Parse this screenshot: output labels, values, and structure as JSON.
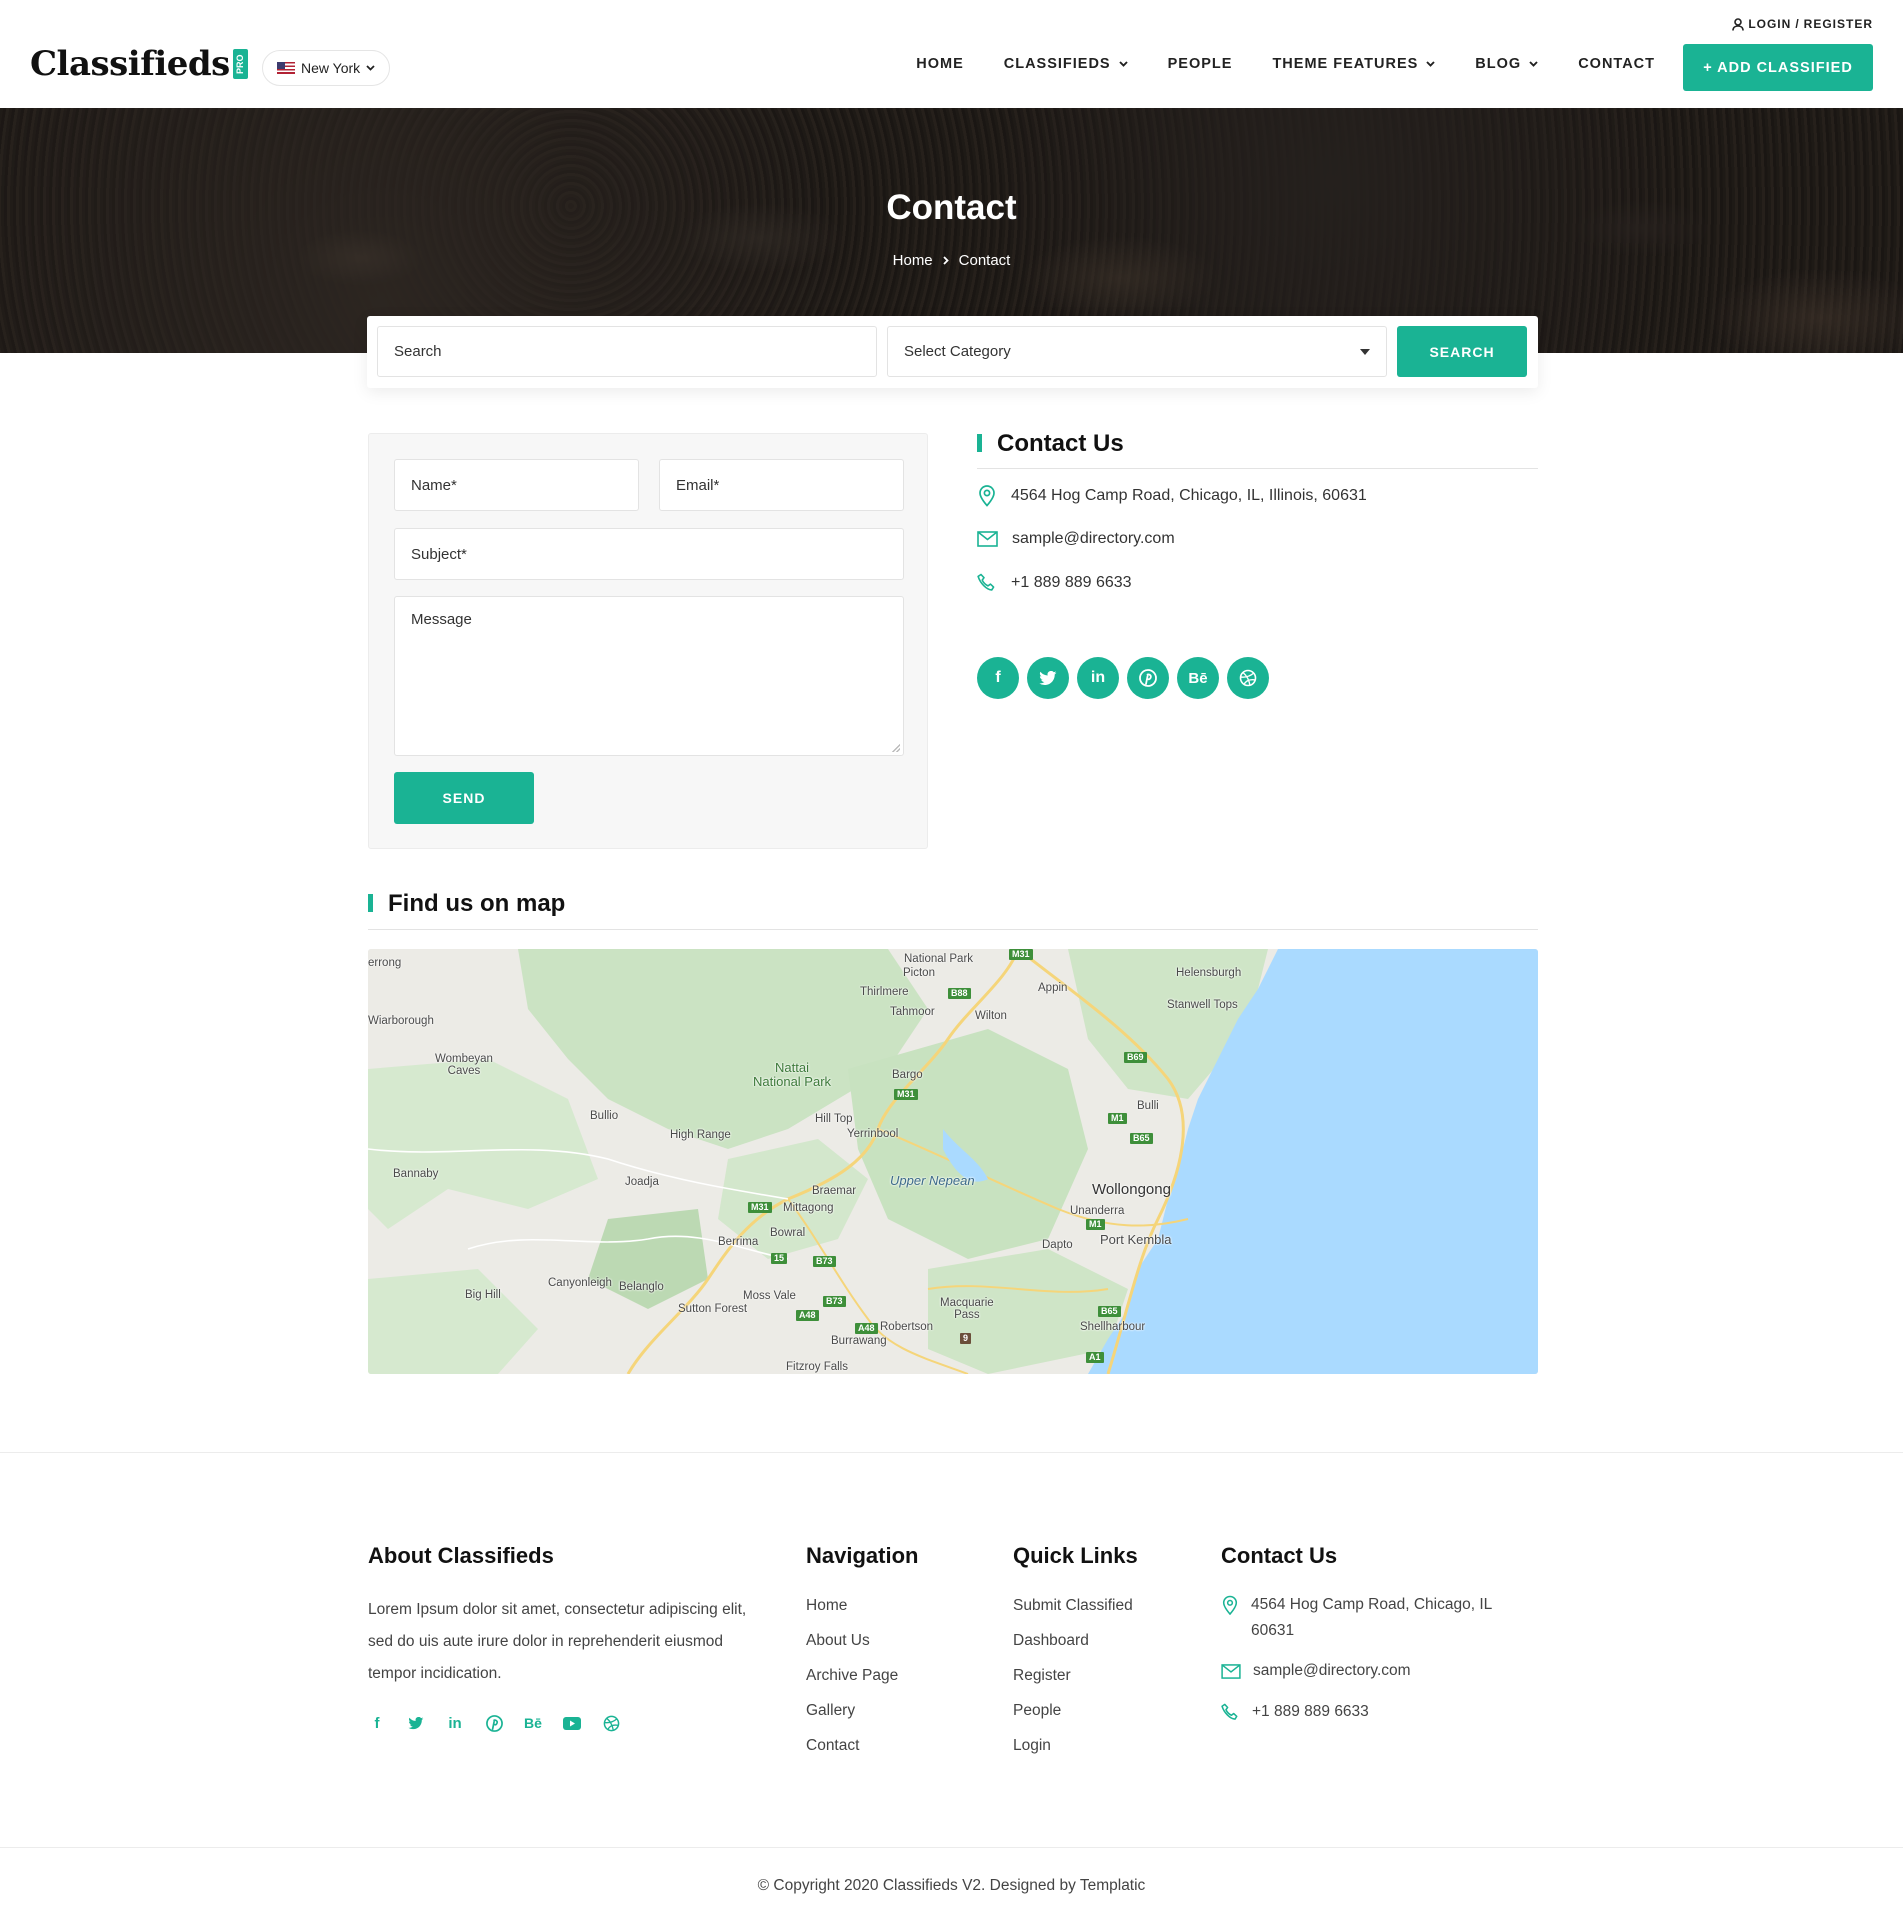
{
  "header": {
    "login_link": "LOGIN",
    "login_sep": "/",
    "register_link": "REGISTER",
    "logo_text": "Classifieds",
    "logo_badge": "PRO",
    "city": "New York",
    "nav": [
      {
        "label": "HOME",
        "dropdown": false
      },
      {
        "label": "CLASSIFIEDS",
        "dropdown": true
      },
      {
        "label": "PEOPLE",
        "dropdown": false
      },
      {
        "label": "THEME FEATURES",
        "dropdown": true
      },
      {
        "label": "BLOG",
        "dropdown": true
      },
      {
        "label": "CONTACT",
        "dropdown": false
      }
    ],
    "add_button": "+ ADD CLASSIFIED"
  },
  "hero": {
    "title": "Contact",
    "breadcrumb_home": "Home",
    "breadcrumb_current": "Contact"
  },
  "search": {
    "placeholder": "Search",
    "category": "Select Category",
    "button": "SEARCH"
  },
  "form": {
    "name_placeholder": "Name*",
    "email_placeholder": "Email*",
    "subject_placeholder": "Subject*",
    "message_placeholder": "Message",
    "send_button": "SEND"
  },
  "contact": {
    "title": "Contact Us",
    "address": "4564 Hog Camp Road, Chicago, IL, Illinois, 60631",
    "email": "sample@directory.com",
    "phone": "+1 889 889 6633",
    "socials": [
      "facebook-icon",
      "twitter-icon",
      "linkedin-icon",
      "pinterest-icon",
      "behance-icon",
      "dribbble-icon"
    ]
  },
  "map": {
    "title": "Find us on map",
    "labels": {
      "national_park_top": "National Park",
      "picton": "Picton",
      "thirlmere": "Thirlmere",
      "tahmoor": "Tahmoor",
      "appin": "Appin",
      "wilton": "Wilton",
      "helensburgh": "Helensburgh",
      "stanwell_tops": "Stanwell Tops",
      "errong": "errong",
      "wiarborough": "Wiarborough",
      "wombeyan": "Wombeyan\nCaves",
      "nattai": "Nattai\nNational Park",
      "bargo": "Bargo",
      "bullio": "Bullio",
      "hill_top": "Hill Top",
      "yerrinbool": "Yerrinbool",
      "high_range": "High Range",
      "bulli": "Bulli",
      "bannaby": "Bannaby",
      "joadja": "Joadja",
      "braemar": "Braemar",
      "upper_nepean": "Upper Nepean",
      "wollongong": "Wollongong",
      "mittagong": "Mittagong",
      "unanderra": "Unanderra",
      "bowral": "Bowral",
      "berrima": "Berrima",
      "dapto": "Dapto",
      "port_kembla": "Port Kembla",
      "canyonleigh": "Canyonleigh",
      "belanglo": "Belanglo",
      "big_hill": "Big Hill",
      "moss_vale": "Moss Vale",
      "macquarie_pass": "Macquarie\nPass",
      "sutton_forest": "Sutton Forest",
      "robertson": "Robertson",
      "shellharbour": "Shellharbour",
      "burrawang": "Burrawang",
      "fitzroy_falls": "Fitzroy Falls"
    },
    "shields": {
      "m31_top": "M31",
      "b88": "B88",
      "b69": "B69",
      "m31_mid": "M31",
      "m1_a": "M1",
      "b65_a": "B65",
      "m31_low": "M31",
      "n15": "15",
      "b73_a": "B73",
      "b73_b": "B73",
      "a48_a": "A48",
      "a48_b": "A48",
      "m1_b": "M1",
      "b65_b": "B65",
      "a1": "A1",
      "n9": "9"
    }
  },
  "footer": {
    "about_title": "About Classifieds",
    "about_text": "Lorem Ipsum dolor sit amet, consectetur adipiscing elit, sed do uis aute irure dolor in reprehenderit eiusmod tempor incidication.",
    "about_socials": [
      "facebook-icon",
      "twitter-icon",
      "linkedin-icon",
      "pinterest-icon",
      "behance-icon",
      "youtube-icon",
      "dribbble-icon"
    ],
    "nav_title": "Navigation",
    "nav_links": [
      "Home",
      "About Us",
      "Archive Page",
      "Gallery",
      "Contact"
    ],
    "quick_title": "Quick Links",
    "quick_links": [
      "Submit Classified",
      "Dashboard",
      "Register",
      "People",
      "Login"
    ],
    "contact_title": "Contact Us",
    "contact_address": "4564 Hog Camp Road, Chicago, IL 60631",
    "contact_email": "sample@directory.com",
    "contact_phone": "+1 889 889 6633",
    "copyright": "© Copyright 2020 Classifieds V2. Designed by Templatic"
  },
  "colors": {
    "accent": "#1ab394",
    "text_dark": "#111111",
    "text_body": "#444444",
    "map_water": "#aadaff",
    "map_green": "#c8e2c0"
  }
}
